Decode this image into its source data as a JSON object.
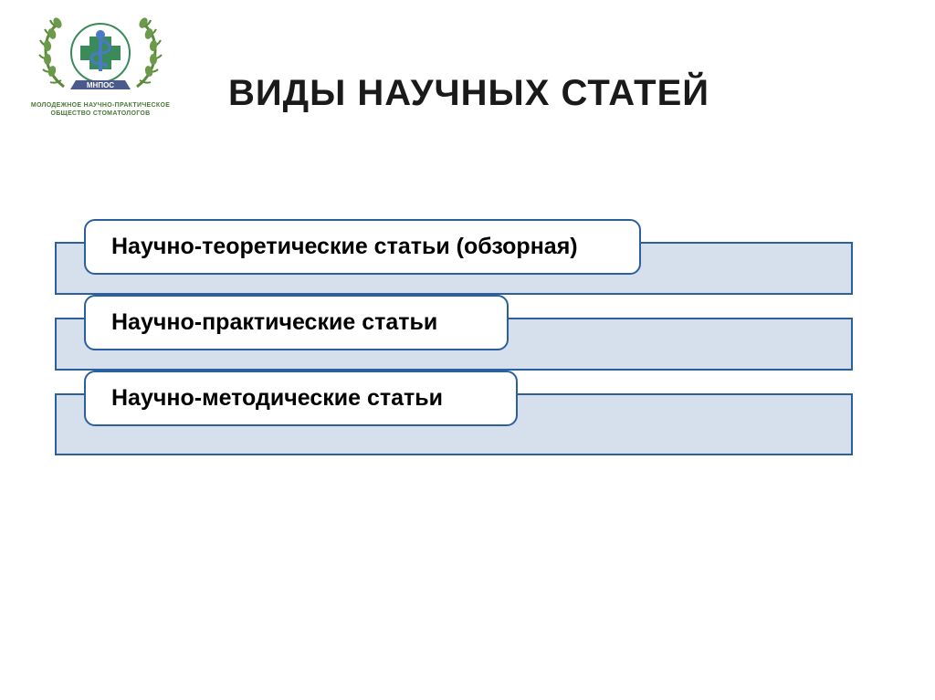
{
  "logo": {
    "org_text_line1": "МОЛОДЕЖНОЕ НАУЧНО-ПРАКТИЧЕСКОЕ",
    "org_text_line2": "ОБЩЕСТВО СТОМАТОЛОГОВ",
    "banner": "МНПОС"
  },
  "title": "ВИДЫ НАУЧНЫХ СТАТЕЙ",
  "items": [
    {
      "label": "Научно-теоретические статьи (обзорная)"
    },
    {
      "label": "Научно-практические статьи"
    },
    {
      "label": "Научно-методические статьи"
    }
  ],
  "colors": {
    "accent": "#2b5f9e",
    "bg_fill": "#d6e0ed",
    "laurel": "#5a8a3a",
    "cross": "#3a8a5a",
    "staff": "#4a7ac4"
  }
}
